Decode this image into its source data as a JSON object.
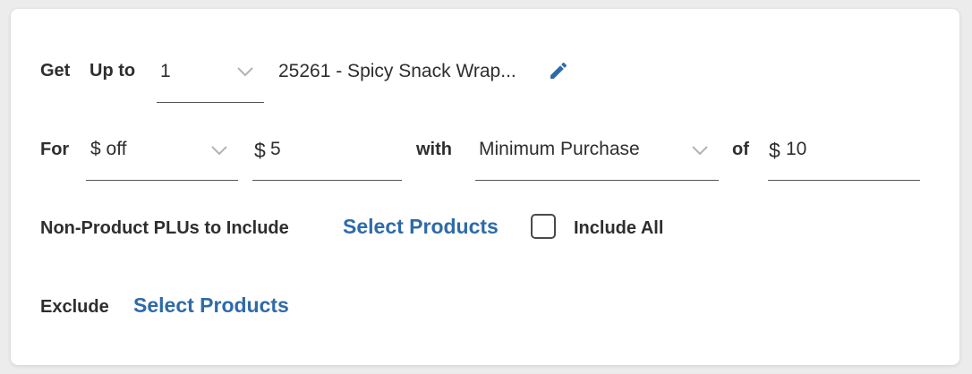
{
  "get_row": {
    "get_label": "Get",
    "up_to_label": "Up to",
    "quantity_value": "1",
    "product_text": "25261 - Spicy Snack Wrap..."
  },
  "for_row": {
    "for_label": "For",
    "discount_type_value": "$ off",
    "currency_symbol": "$",
    "discount_amount": "5",
    "with_label": "with",
    "condition_value": "Minimum Purchase",
    "of_label": "of",
    "minimum_currency_symbol": "$",
    "minimum_amount": "10"
  },
  "plu_row": {
    "label": "Non-Product PLUs to Include",
    "select_link": "Select Products",
    "include_all_label": "Include All",
    "include_all_checked": false
  },
  "exclude_row": {
    "label": "Exclude",
    "select_link": "Select Products"
  },
  "colors": {
    "link": "#2f6aa8",
    "edit_icon": "#2f6aa8",
    "text": "#2e2e2e"
  },
  "icons": {
    "dropdown": "chevron-down-icon",
    "edit": "pencil-icon"
  }
}
